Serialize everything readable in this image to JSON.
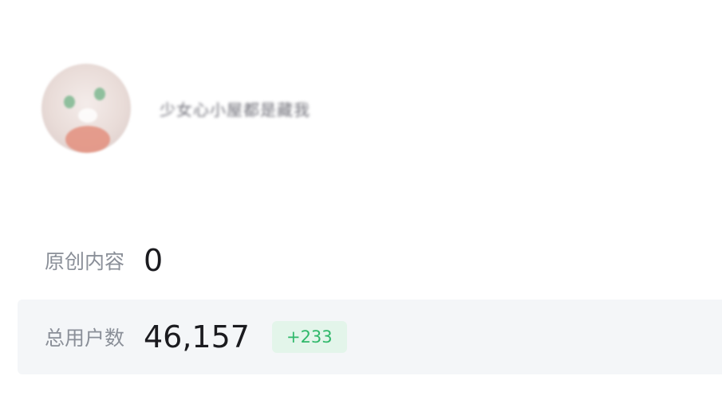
{
  "profile": {
    "username": "少女心小屋都是藏我"
  },
  "stats": {
    "original": {
      "label": "原创内容",
      "value": "0"
    },
    "users": {
      "label": "总用户数",
      "value": "46,157",
      "delta": "+233"
    }
  },
  "colors": {
    "badge_bg": "#e3f5ea",
    "badge_text": "#2fb86a",
    "row_highlight": "#f4f6f8"
  }
}
